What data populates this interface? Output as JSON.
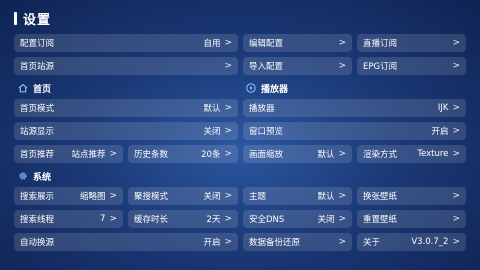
{
  "page": {
    "title": "设置"
  },
  "top": [
    {
      "label": "配置订阅",
      "value": "自用",
      "chev": ">"
    },
    {
      "label": "编辑配置",
      "value": "",
      "chev": ">"
    },
    {
      "label": "直播订阅",
      "value": "",
      "chev": ">"
    },
    {
      "label": "首页站源",
      "value": "",
      "chev": ">"
    },
    {
      "label": "导入配置",
      "value": "",
      "chev": ">"
    },
    {
      "label": "EPG订阅",
      "value": "",
      "chev": ">"
    }
  ],
  "sections": {
    "home": {
      "title": "首页",
      "icon": "home-icon"
    },
    "player": {
      "title": "播放器",
      "icon": "play-circle-icon"
    },
    "system": {
      "title": "系统",
      "icon": "gear-icon"
    }
  },
  "home": [
    {
      "label": "首页模式",
      "value": "默认",
      "chev": ">"
    },
    {
      "label": "站源显示",
      "value": "关闭",
      "chev": ">"
    },
    {
      "label": "首页推荐",
      "value": "站点推荐",
      "chev": ">"
    },
    {
      "label": "历史条数",
      "value": "20条",
      "chev": ">"
    }
  ],
  "player": [
    {
      "label": "播放器",
      "value": "IJK",
      "chev": ">"
    },
    {
      "label": "窗口预览",
      "value": "开启",
      "chev": ">"
    },
    {
      "label": "画面缩放",
      "value": "默认",
      "chev": ">"
    },
    {
      "label": "渲染方式",
      "value": "Texture",
      "chev": ">"
    }
  ],
  "system": [
    {
      "label": "搜索展示",
      "value": "缩略图",
      "chev": ">"
    },
    {
      "label": "聚搜模式",
      "value": "关闭",
      "chev": ">"
    },
    {
      "label": "主题",
      "value": "默认",
      "chev": ">"
    },
    {
      "label": "换张壁纸",
      "value": "",
      "chev": ">"
    },
    {
      "label": "搜索线程",
      "value": "7",
      "chev": ">"
    },
    {
      "label": "缓存时长",
      "value": "2天",
      "chev": ">"
    },
    {
      "label": "安全DNS",
      "value": "关闭",
      "chev": ">"
    },
    {
      "label": "重置壁纸",
      "value": "",
      "chev": ">"
    },
    {
      "label": "自动换源",
      "value": "开启",
      "chev": ">"
    },
    {
      "label": "数据备份还原",
      "value": "",
      "chev": ">"
    },
    {
      "label": "关于",
      "value": "V3.0.7_2",
      "chev": ">"
    }
  ]
}
